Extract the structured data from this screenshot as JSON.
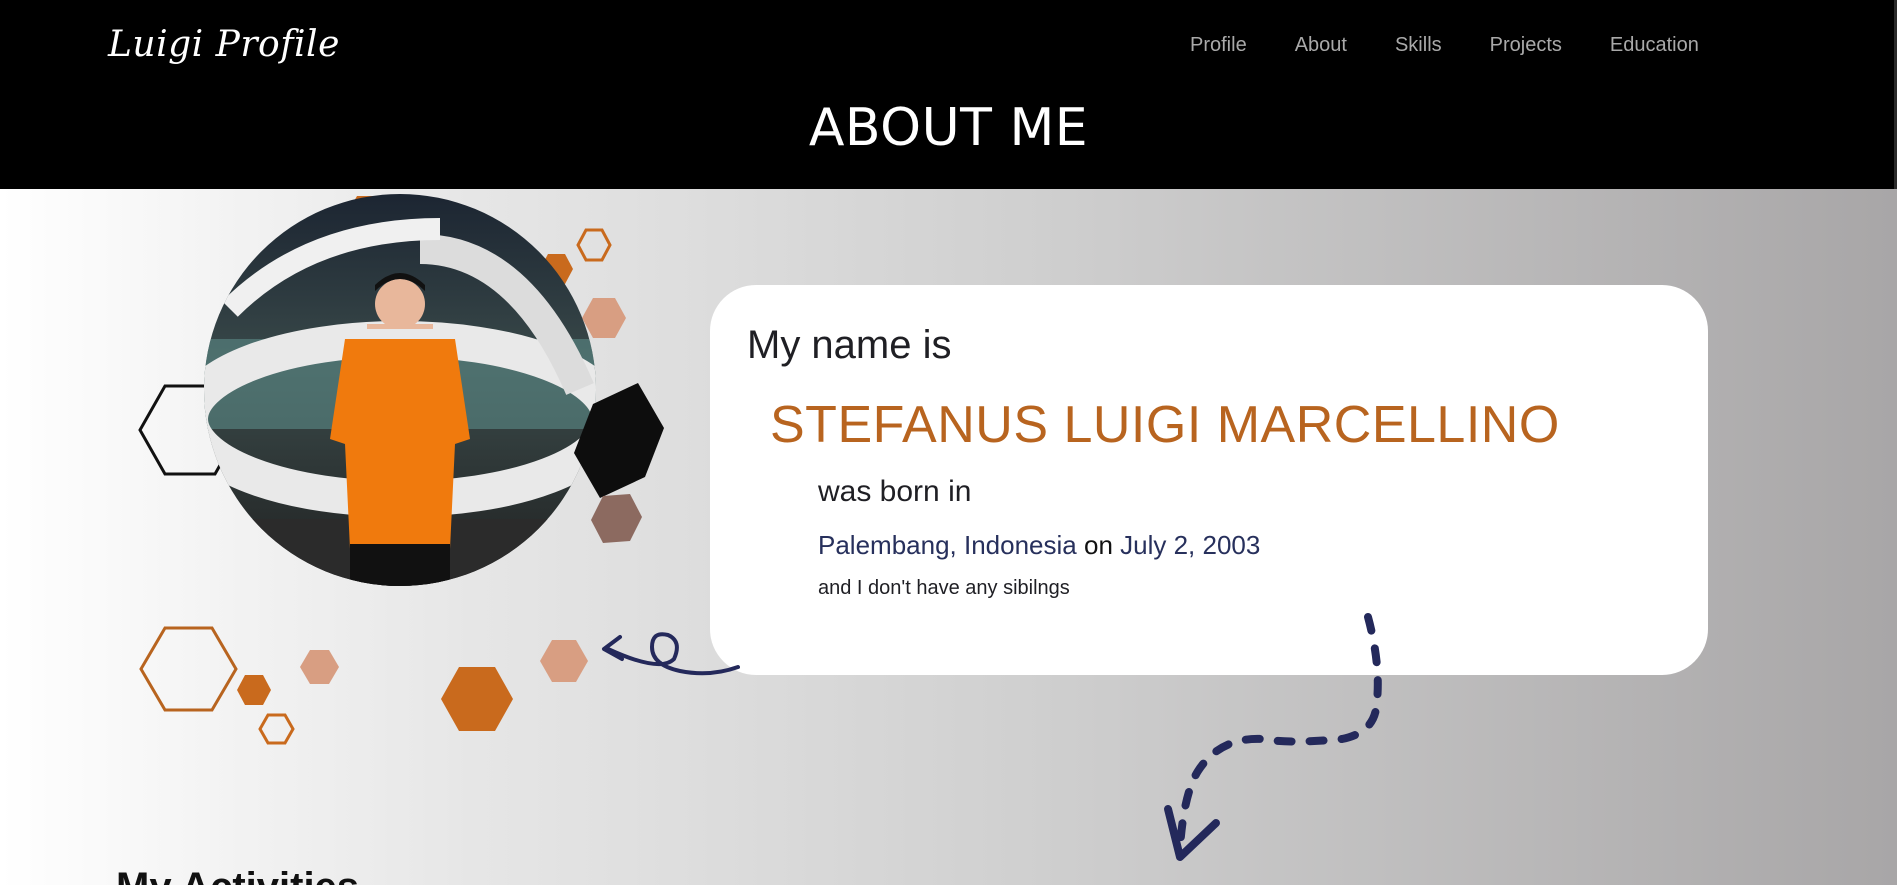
{
  "header": {
    "brand": "Luigi Profile",
    "nav": [
      "Profile",
      "About",
      "Skills",
      "Projects",
      "Education"
    ],
    "page_title": "ABOUT ME"
  },
  "about": {
    "intro": "My name is",
    "full_name": "STEFANUS LUIGI MARCELLINO",
    "born_text": "was born in",
    "birthplace": "Palembang, Indonesia",
    "on_text": "on",
    "birth_date": "July 2, 2003",
    "siblings": "and I don't have any sibilngs"
  },
  "next_section": {
    "title_partial": "My Activities"
  },
  "colors": {
    "header_bg": "#000000",
    "accent_orange": "#b8641f",
    "accent_navy": "#27305c",
    "hex_orange": "#c96a1d",
    "hex_peach": "#d89e82",
    "hex_brown": "#8c6a60"
  },
  "icons": [
    "hexagon-decoration",
    "profile-photo",
    "curl-arrow-icon",
    "dashed-arrow-icon"
  ]
}
